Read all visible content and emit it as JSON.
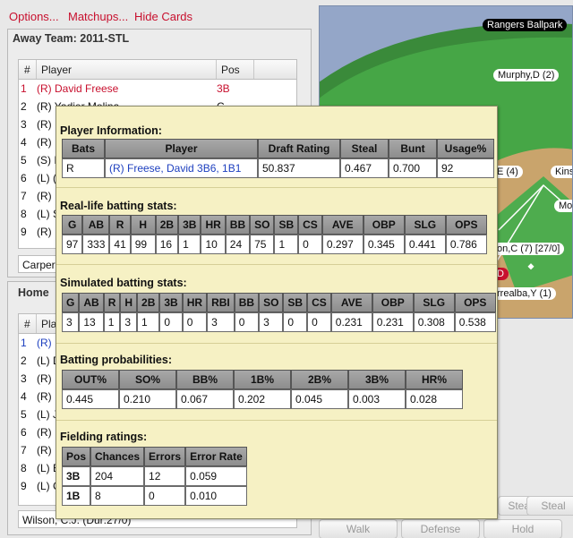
{
  "menu": {
    "options": "Options...",
    "matchups": "Matchups...",
    "hide_cards": "Hide Cards"
  },
  "away": {
    "title": "Away Team: 2011-STL",
    "headers": [
      "#",
      "Player",
      "Pos"
    ],
    "rows": [
      {
        "num": "1",
        "name": "(R) David Freese",
        "pos": "3B"
      },
      {
        "num": "2",
        "name": "(R) Yadier Molina",
        "pos": "C"
      },
      {
        "num": "3",
        "name": "(R)",
        "pos": ""
      },
      {
        "num": "4",
        "name": "(R)",
        "pos": ""
      },
      {
        "num": "5",
        "name": "(S) I",
        "pos": ""
      },
      {
        "num": "6",
        "name": "(L) (",
        "pos": ""
      },
      {
        "num": "7",
        "name": "(R)",
        "pos": ""
      },
      {
        "num": "8",
        "name": "(L) S",
        "pos": ""
      },
      {
        "num": "9",
        "name": "(R)",
        "pos": ""
      }
    ],
    "pitcher": "Carper"
  },
  "home": {
    "title": "Home",
    "headers": [
      "#",
      "Pla"
    ],
    "rows": [
      {
        "num": "1",
        "name": "(R)"
      },
      {
        "num": "2",
        "name": "(L) D"
      },
      {
        "num": "3",
        "name": "(R)"
      },
      {
        "num": "4",
        "name": "(R)"
      },
      {
        "num": "5",
        "name": "(L) J"
      },
      {
        "num": "6",
        "name": "(R)"
      },
      {
        "num": "7",
        "name": "(R)"
      },
      {
        "num": "8",
        "name": "(L) E"
      },
      {
        "num": "9",
        "name": "(L) C"
      }
    ],
    "pitcher": "Wilson, C.J. (Dur:27/0)"
  },
  "field": {
    "ballpark": "Rangers Ballpark",
    "labels": [
      "Murphy,D (2)",
      "E (4)",
      "Kins",
      "Mo",
      "on,C (7) [27/0]",
      "D",
      "rrealba,Y (1)"
    ]
  },
  "buttons": {
    "steal_top": "Steal",
    "walk": "Walk",
    "defense": "Defense",
    "hold": "Hold",
    "steal": "Steal"
  },
  "popup": {
    "player_info": {
      "title": "Player Information:",
      "headers": [
        "Bats",
        "Player",
        "Draft Rating",
        "Steal",
        "Bunt",
        "Usage%"
      ],
      "row": [
        "R",
        "(R) Freese, David 3B6, 1B1",
        "50.837",
        "0.467",
        "0.700",
        "92"
      ]
    },
    "real": {
      "title": "Real-life batting stats:",
      "headers": [
        "G",
        "AB",
        "R",
        "H",
        "2B",
        "3B",
        "HR",
        "BB",
        "SO",
        "SB",
        "CS",
        "AVE",
        "OBP",
        "SLG",
        "OPS"
      ],
      "row": [
        "97",
        "333",
        "41",
        "99",
        "16",
        "1",
        "10",
        "24",
        "75",
        "1",
        "0",
        "0.297",
        "0.345",
        "0.441",
        "0.786"
      ]
    },
    "sim": {
      "title": "Simulated batting stats:",
      "headers": [
        "G",
        "AB",
        "R",
        "H",
        "2B",
        "3B",
        "HR",
        "RBI",
        "BB",
        "SO",
        "SB",
        "CS",
        "AVE",
        "OBP",
        "SLG",
        "OPS"
      ],
      "row": [
        "3",
        "13",
        "1",
        "3",
        "1",
        "0",
        "0",
        "3",
        "0",
        "3",
        "0",
        "0",
        "0.231",
        "0.231",
        "0.308",
        "0.538"
      ]
    },
    "prob": {
      "title": "Batting probabilities:",
      "headers": [
        "OUT%",
        "SO%",
        "BB%",
        "1B%",
        "2B%",
        "3B%",
        "HR%"
      ],
      "row": [
        "0.445",
        "0.210",
        "0.067",
        "0.202",
        "0.045",
        "0.003",
        "0.028"
      ]
    },
    "fielding": {
      "title": "Fielding ratings:",
      "headers": [
        "Pos",
        "Chances",
        "Errors",
        "Error Rate"
      ],
      "rows": [
        [
          "3B",
          "204",
          "12",
          "0.059"
        ],
        [
          "1B",
          "8",
          "0",
          "0.010"
        ]
      ]
    }
  }
}
